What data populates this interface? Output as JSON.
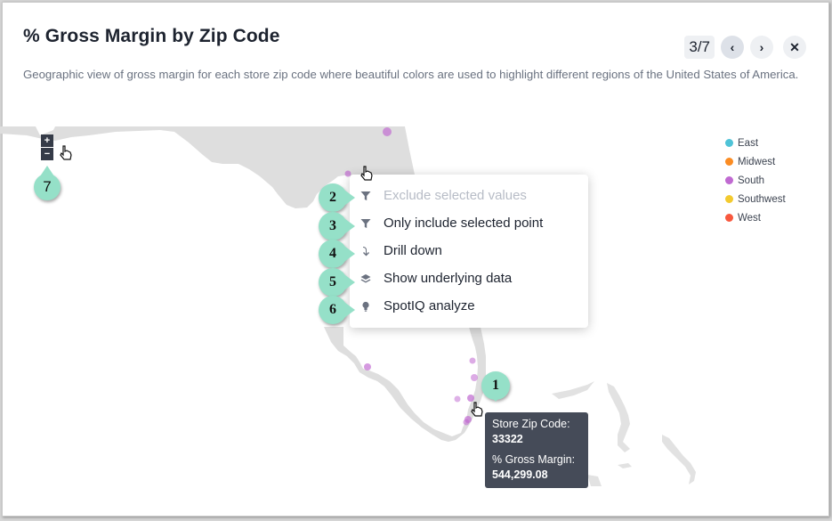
{
  "header": {
    "title": "% Gross Margin by Zip Code",
    "description": "Geographic view of gross margin for each store zip code where beautiful colors are used to highlight different regions of the United States of America."
  },
  "pager": {
    "count": "3/7",
    "prev_icon": "chevron-left-icon",
    "next_icon": "chevron-right-icon",
    "close_icon": "close-icon",
    "prev_glyph": "‹",
    "next_glyph": "›",
    "close_glyph": "✕"
  },
  "zoom_controls": {
    "zoom_in": "+",
    "zoom_out": "−"
  },
  "legend": {
    "items": [
      {
        "label": "East",
        "color": "#4fc3d7"
      },
      {
        "label": "Midwest",
        "color": "#fb8c23"
      },
      {
        "label": "South",
        "color": "#c06ad1"
      },
      {
        "label": "Southwest",
        "color": "#f3ca2f"
      },
      {
        "label": "West",
        "color": "#f8583e"
      }
    ]
  },
  "context_menu": {
    "items": [
      {
        "label": "Exclude selected values",
        "icon": "filter-icon",
        "disabled": true
      },
      {
        "label": "Only include selected point",
        "icon": "filter-icon",
        "disabled": false
      },
      {
        "label": "Drill down",
        "icon": "drill-down-arrow-icon",
        "disabled": false
      },
      {
        "label": "Show underlying data",
        "icon": "layers-icon",
        "disabled": false
      },
      {
        "label": "SpotIQ analyze",
        "icon": "lightbulb-icon",
        "disabled": false
      }
    ]
  },
  "tooltip": {
    "zip_label": "Store Zip Code:",
    "zip_value": "33322",
    "margin_label": "% Gross Margin:",
    "margin_value": "544,299.08"
  },
  "callouts": [
    "1",
    "2",
    "3",
    "4",
    "5",
    "6",
    "7"
  ],
  "map": {
    "land_color": "#dedede",
    "point_color": "#c06ad1",
    "region_shown": "South"
  }
}
